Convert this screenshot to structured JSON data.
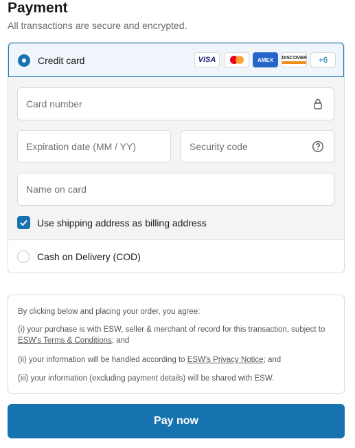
{
  "header": {
    "title": "Payment",
    "subtitle": "All transactions are secure and encrypted."
  },
  "credit_card": {
    "label": "Credit card",
    "selected": true,
    "brands": {
      "visa": "VISA",
      "amex": "AMEX",
      "discover": "DISCOVER",
      "more": "+6"
    },
    "fields": {
      "card_number": "Card number",
      "expiration": "Expiration date (MM / YY)",
      "security_code": "Security code",
      "name_on_card": "Name on card"
    },
    "billing_checkbox": {
      "label": "Use shipping address as billing address",
      "checked": true
    }
  },
  "cod": {
    "label": "Cash on Delivery (COD)",
    "selected": false
  },
  "terms": {
    "intro": "By clicking below and placing your order, you agree:",
    "item1_a": "(i) your purchase is with ESW, seller & merchant of record for this transaction, subject to ",
    "item1_link": "ESW's Terms & Conditions",
    "item1_b": "; and",
    "item2_a": "(ii) your information will be handled according to ",
    "item2_link": "ESW's Privacy Notice",
    "item2_b": "; and",
    "item3": "(iii) your information (excluding payment details) will be shared with ESW."
  },
  "pay_button": "Pay now",
  "colors": {
    "accent": "#1773b0",
    "selected_bg": "#f0f5fc",
    "panel_bg": "#f4f4f4"
  }
}
